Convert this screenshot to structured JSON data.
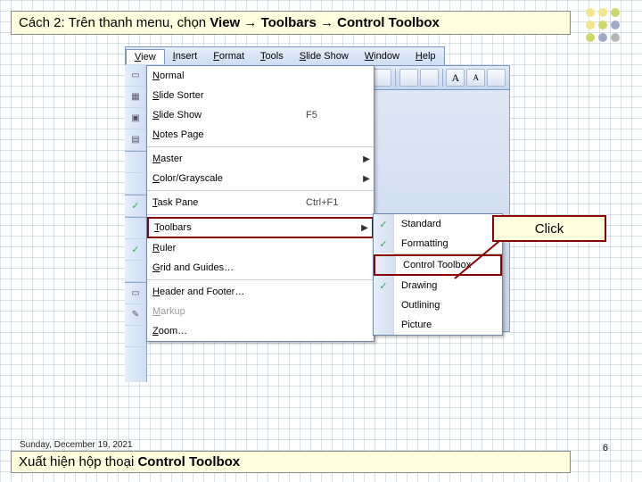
{
  "title": {
    "prefix": "Cách 2: Trên thanh menu, chọn ",
    "step1": "View",
    "step2": "Toolbars",
    "step3": "Control Toolbox",
    "arrow": " → "
  },
  "menubar": [
    "View",
    "Insert",
    "Format",
    "Tools",
    "Slide Show",
    "Window",
    "Help"
  ],
  "view_menu": [
    {
      "label": "Normal",
      "sc": "",
      "tri": "",
      "check": false
    },
    {
      "label": "Slide Sorter",
      "sc": "",
      "tri": "",
      "check": false
    },
    {
      "label": "Slide Show",
      "sc": "F5",
      "tri": "",
      "check": false
    },
    {
      "label": "Notes Page",
      "sc": "",
      "tri": "",
      "check": false
    },
    {
      "sep": true
    },
    {
      "label": "Master",
      "sc": "",
      "tri": "▶",
      "check": false
    },
    {
      "label": "Color/Grayscale",
      "sc": "",
      "tri": "▶",
      "check": false
    },
    {
      "sep": true
    },
    {
      "label": "Task Pane",
      "sc": "Ctrl+F1",
      "tri": "",
      "check": true
    },
    {
      "sep": true
    },
    {
      "label": "Toolbars",
      "sc": "",
      "tri": "▶",
      "check": false,
      "highlight": true
    },
    {
      "label": "Ruler",
      "sc": "",
      "tri": "",
      "check": true
    },
    {
      "label": "Grid and Guides…",
      "sc": "",
      "tri": "",
      "check": false
    },
    {
      "sep": true
    },
    {
      "label": "Header and Footer…",
      "sc": "",
      "tri": "",
      "check": false
    },
    {
      "label": "Markup",
      "sc": "",
      "tri": "",
      "check": false,
      "dim": true
    },
    {
      "label": "Zoom…",
      "sc": "",
      "tri": "",
      "check": false
    }
  ],
  "submenu": [
    {
      "label": "Standard",
      "check": true
    },
    {
      "label": "Formatting",
      "check": true
    },
    {
      "sep": true
    },
    {
      "label": "Control Toolbox",
      "check": false,
      "highlight": true
    },
    {
      "label": "Drawing",
      "check": true
    },
    {
      "label": "Outlining",
      "check": false
    },
    {
      "label": "Picture",
      "check": false
    }
  ],
  "callout": "Click",
  "footer": {
    "date": "Sunday, December 19, 2021",
    "text_prefix": "Xuất hiện hộp thoại ",
    "text_bold": "Control Toolbox",
    "page": "6"
  }
}
